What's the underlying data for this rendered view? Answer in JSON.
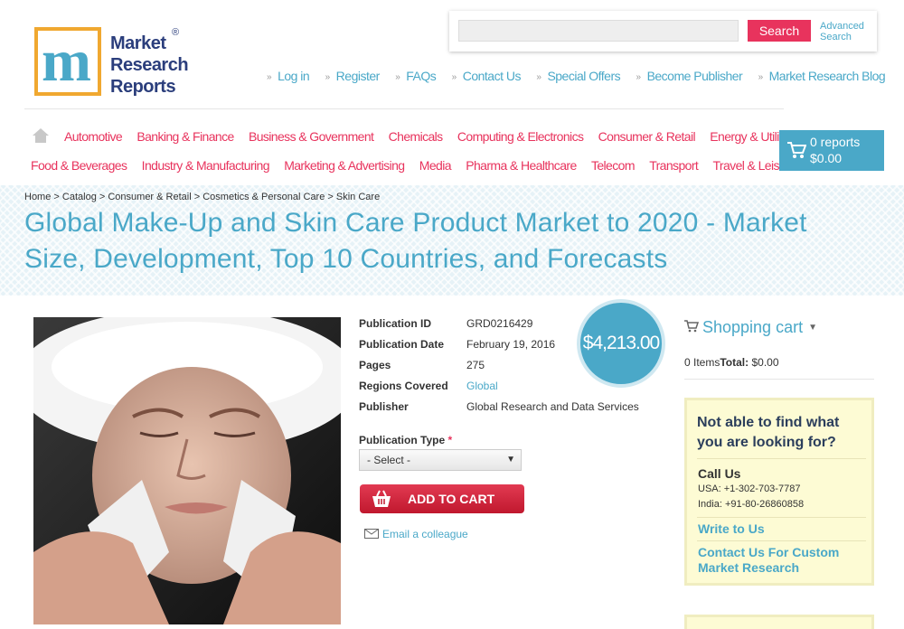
{
  "logo": {
    "mark": "m",
    "line1": "Market",
    "line2": "Research",
    "line3": "Reports",
    "reg": "®"
  },
  "search": {
    "placeholder": "",
    "button": "Search",
    "advanced_line1": "Advanced",
    "advanced_line2": "Search"
  },
  "top_nav": [
    "Log in",
    "Register",
    "FAQs",
    "Contact Us",
    "Special Offers",
    "Become Publisher",
    "Market Research Blog"
  ],
  "categories_row1": [
    "Automotive",
    "Banking & Finance",
    "Business & Government",
    "Chemicals",
    "Computing & Electronics",
    "Consumer & Retail",
    "Energy & Utilities"
  ],
  "categories_row2": [
    "Food & Beverages",
    "Industry & Manufacturing",
    "Marketing & Advertising",
    "Media",
    "Pharma & Healthcare",
    "Telecom",
    "Transport",
    "Travel & Leisure"
  ],
  "cart": {
    "reports": "0 reports",
    "total": "$0.00"
  },
  "breadcrumb": [
    "Home",
    "Catalog",
    "Consumer & Retail",
    "Cosmetics & Personal Care",
    "Skin Care"
  ],
  "breadcrumb_sep": " > ",
  "title": "Global Make-Up and Skin Care Product Market to 2020 - Market Size, Development, Top 10 Countries, and Forecasts",
  "details": {
    "pub_id_label": "Publication ID",
    "pub_id": "GRD0216429",
    "pub_date_label": "Publication Date",
    "pub_date": "February 19, 2016",
    "pages_label": "Pages",
    "pages": "275",
    "regions_label": "Regions Covered",
    "regions": "Global",
    "publisher_label": "Publisher",
    "publisher": "Global Research and Data Services"
  },
  "price": "$4,213.00",
  "pub_type": {
    "label": "Publication Type",
    "required": "*",
    "selected": "- Select -"
  },
  "add_to_cart": "ADD TO CART",
  "email_colleague": "Email a colleague",
  "shopping_cart": {
    "title": "Shopping cart",
    "items": "0 Items",
    "total_label": "Total:",
    "total": "$0.00"
  },
  "help": {
    "title": "Not able to find what you are looking for?",
    "call_title": "Call Us",
    "usa": "USA: +1-302-703-7787",
    "india": "India: +91-80-26860858",
    "write": "Write to Us",
    "custom": "Contact Us For Custom Market Research"
  },
  "colors": {
    "accent": "#4aa8c8",
    "pink": "#e8335d",
    "navy": "#2b3e7c"
  }
}
